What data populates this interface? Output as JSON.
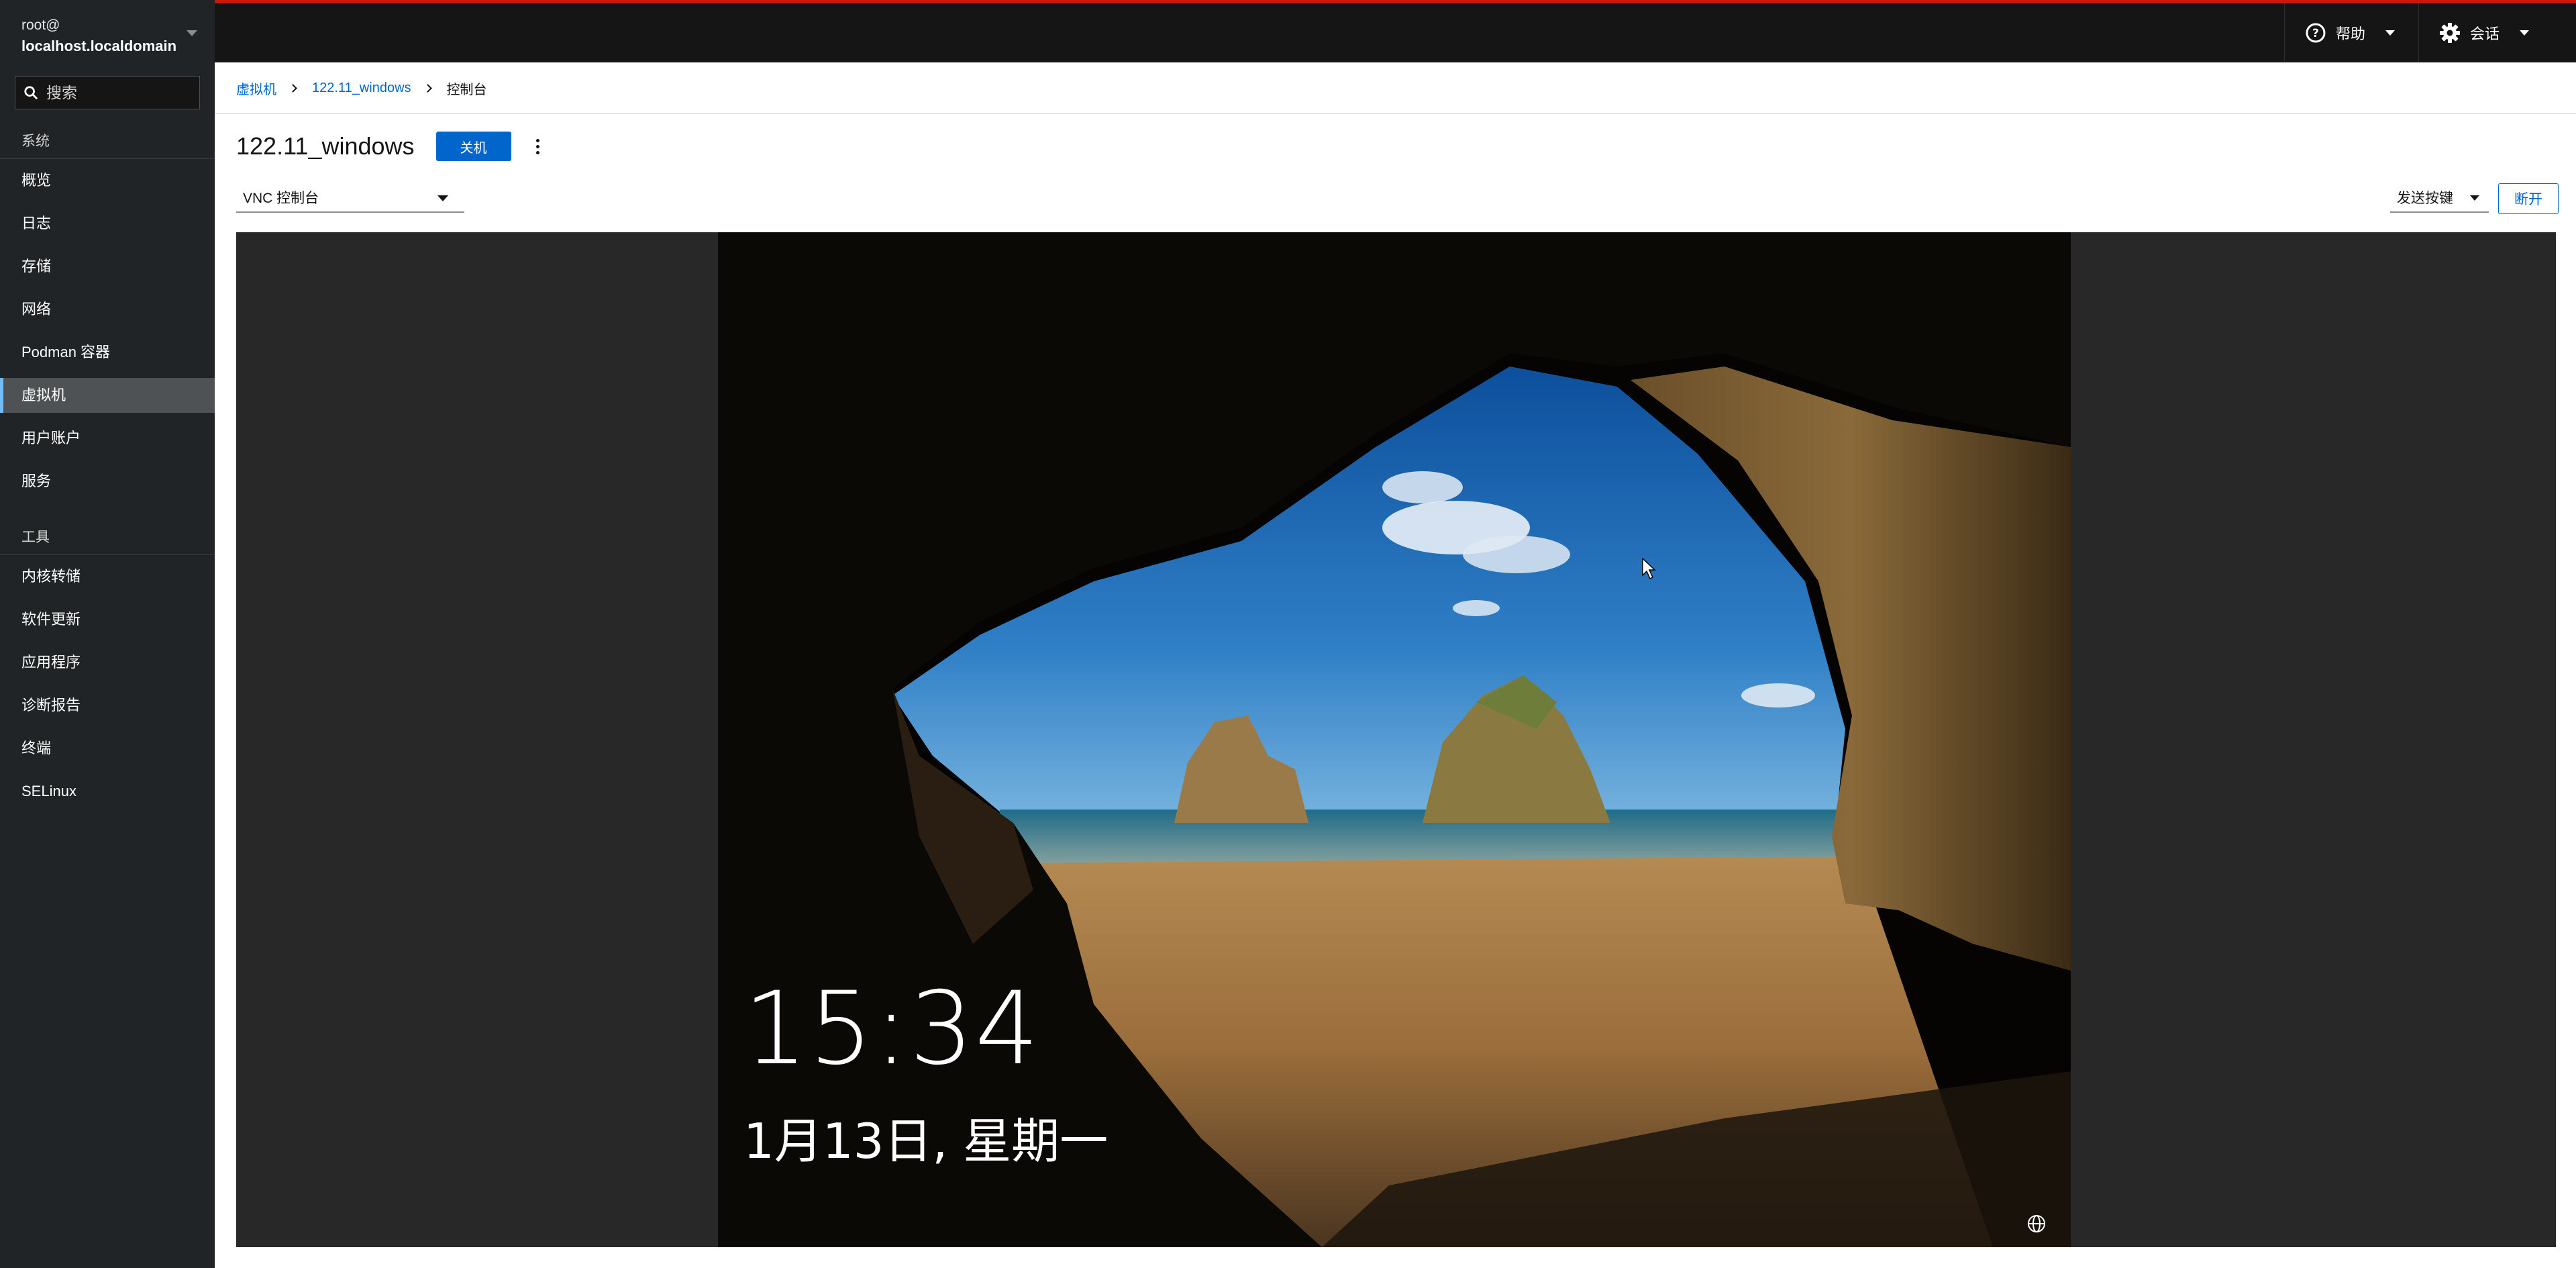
{
  "host": {
    "user": "root@",
    "name": "localhost.localdomain"
  },
  "search": {
    "placeholder": "搜索"
  },
  "sidebar": {
    "section_system": "系统",
    "items": [
      {
        "label": "概览"
      },
      {
        "label": "日志"
      },
      {
        "label": "存储"
      },
      {
        "label": "网络"
      },
      {
        "label": "Podman 容器"
      },
      {
        "label": "虚拟机",
        "active": true
      },
      {
        "label": "用户账户"
      },
      {
        "label": "服务"
      }
    ],
    "section_tools": "工具",
    "tools": [
      {
        "label": "内核转储"
      },
      {
        "label": "软件更新"
      },
      {
        "label": "应用程序"
      },
      {
        "label": "诊断报告"
      },
      {
        "label": "终端"
      },
      {
        "label": "SELinux"
      }
    ]
  },
  "topbar": {
    "help": "帮助",
    "session": "会话",
    "accent": "#c9190b"
  },
  "breadcrumb": {
    "root": "虚拟机",
    "vm": "122.11_windows",
    "current": "控制台"
  },
  "vm": {
    "name": "122.11_windows",
    "shutdown_label": "关机"
  },
  "console": {
    "type": "VNC 控制台",
    "send_key": "发送按键",
    "disconnect": "断开"
  },
  "lockscreen": {
    "time": "15:34",
    "date": "1月13日, 星期一"
  },
  "icons": [
    "search-icon",
    "help-icon",
    "gear-icon",
    "kebab-icon",
    "globe-icon",
    "mouse-cursor-icon"
  ]
}
